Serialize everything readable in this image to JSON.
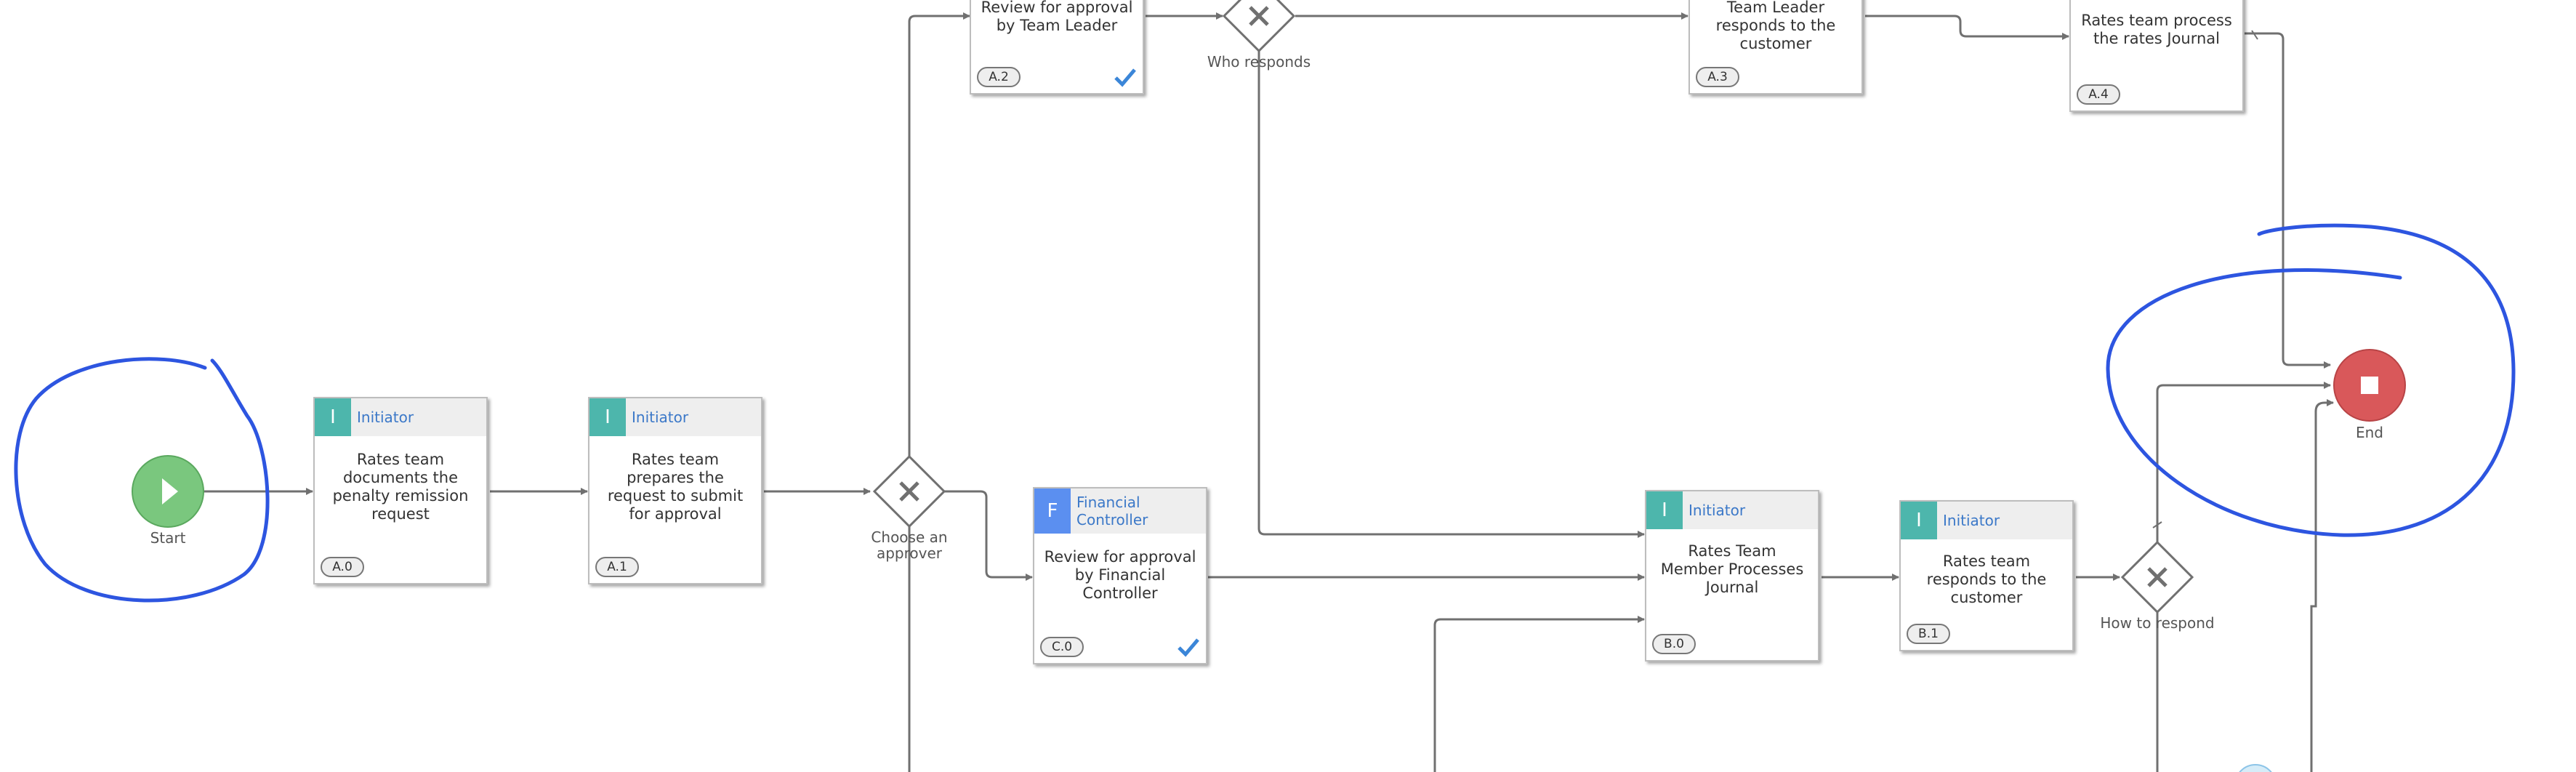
{
  "colors": {
    "initiator": "#4db6ac",
    "financial": "#5b8ff0",
    "start": "#7ac77e",
    "end": "#d9585a",
    "connector": "#707070",
    "annotation": "#2d55e0",
    "check": "#3b86d8"
  },
  "events": {
    "start": {
      "label": "Start"
    },
    "end": {
      "label": "End"
    }
  },
  "gateways": {
    "choose_approver": {
      "label": "Choose an approver"
    },
    "who_responds": {
      "label": "Who responds"
    },
    "how_to_respond": {
      "label": "How to respond"
    }
  },
  "tasks": {
    "a0": {
      "role_initial": "I",
      "role": "Initiator",
      "title": "Rates team documents the penalty remission request",
      "id": "A.0"
    },
    "a1": {
      "role_initial": "I",
      "role": "Initiator",
      "title": "Rates team prepares the request to submit for approval",
      "id": "A.1"
    },
    "a2": {
      "title": "Review for approval by Team Leader",
      "id": "A.2",
      "checked": true
    },
    "a3": {
      "title": "Team Leader responds to the customer",
      "id": "A.3"
    },
    "a4": {
      "title": "Rates team process the rates Journal",
      "id": "A.4"
    },
    "c0": {
      "role_initial": "F",
      "role": "Financial Controller",
      "title": "Review for approval by Financial Controller",
      "id": "C.0",
      "checked": true
    },
    "b0": {
      "role_initial": "I",
      "role": "Initiator",
      "title": "Rates Team Member Processes Journal",
      "id": "B.0"
    },
    "b1": {
      "role_initial": "I",
      "role": "Initiator",
      "title": "Rates team responds to the customer",
      "id": "B.1"
    }
  },
  "icons": {
    "start": "play-icon",
    "end": "stop-icon",
    "gateway": "x-icon",
    "check": "checkmark-icon"
  }
}
